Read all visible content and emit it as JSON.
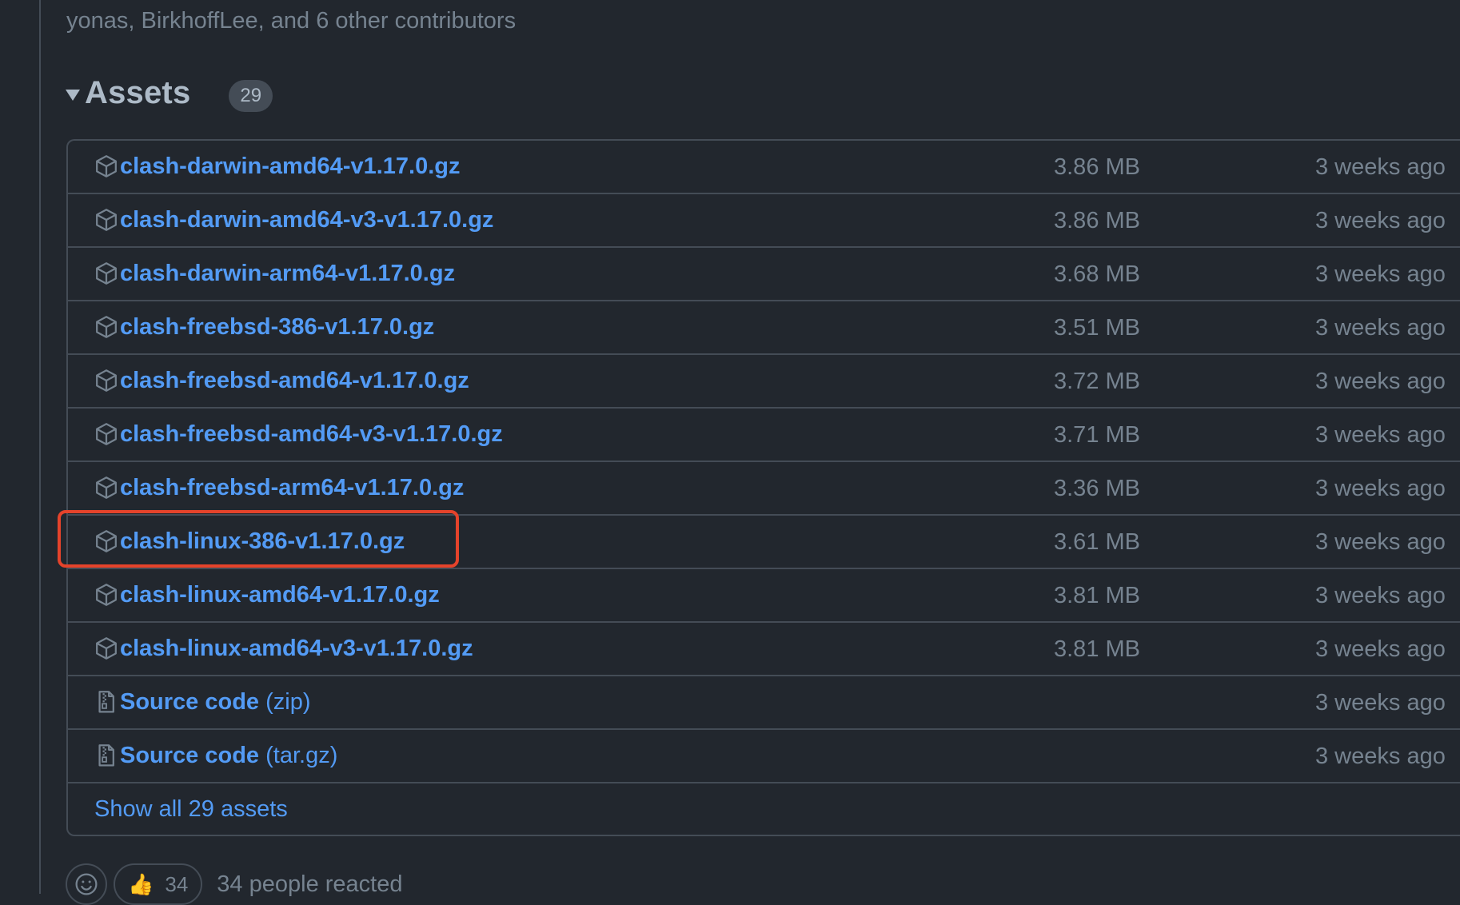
{
  "release": {
    "contributors_text": "yonas, BirkhoffLee, and 6 other contributors"
  },
  "assets": {
    "title": "Assets",
    "count": "29",
    "items": [
      {
        "name": "clash-darwin-amd64-v1.17.0.gz",
        "suffix": "",
        "size": "3.86 MB",
        "date": "3 weeks ago",
        "icon": "package-icon"
      },
      {
        "name": "clash-darwin-amd64-v3-v1.17.0.gz",
        "suffix": "",
        "size": "3.86 MB",
        "date": "3 weeks ago",
        "icon": "package-icon"
      },
      {
        "name": "clash-darwin-arm64-v1.17.0.gz",
        "suffix": "",
        "size": "3.68 MB",
        "date": "3 weeks ago",
        "icon": "package-icon"
      },
      {
        "name": "clash-freebsd-386-v1.17.0.gz",
        "suffix": "",
        "size": "3.51 MB",
        "date": "3 weeks ago",
        "icon": "package-icon"
      },
      {
        "name": "clash-freebsd-amd64-v1.17.0.gz",
        "suffix": "",
        "size": "3.72 MB",
        "date": "3 weeks ago",
        "icon": "package-icon"
      },
      {
        "name": "clash-freebsd-amd64-v3-v1.17.0.gz",
        "suffix": "",
        "size": "3.71 MB",
        "date": "3 weeks ago",
        "icon": "package-icon"
      },
      {
        "name": "clash-freebsd-arm64-v1.17.0.gz",
        "suffix": "",
        "size": "3.36 MB",
        "date": "3 weeks ago",
        "icon": "package-icon"
      },
      {
        "name": "clash-linux-386-v1.17.0.gz",
        "suffix": "",
        "size": "3.61 MB",
        "date": "3 weeks ago",
        "icon": "package-icon"
      },
      {
        "name": "clash-linux-amd64-v1.17.0.gz",
        "suffix": "",
        "size": "3.81 MB",
        "date": "3 weeks ago",
        "icon": "package-icon"
      },
      {
        "name": "clash-linux-amd64-v3-v1.17.0.gz",
        "suffix": "",
        "size": "3.81 MB",
        "date": "3 weeks ago",
        "icon": "package-icon"
      },
      {
        "name": "Source code",
        "suffix": "(zip)",
        "size": "",
        "date": "3 weeks ago",
        "icon": "file-zip-icon"
      },
      {
        "name": "Source code",
        "suffix": "(tar.gz)",
        "size": "",
        "date": "3 weeks ago",
        "icon": "file-zip-icon"
      }
    ],
    "show_all_label": "Show all 29 assets",
    "highlight_color": "#e5432b"
  },
  "reactions": {
    "thumbs_up_count": "34",
    "summary": "34 people reacted"
  },
  "colors": {
    "background": "#22272e",
    "link": "#539bf5",
    "muted": "#768390",
    "border": "#444c56"
  }
}
